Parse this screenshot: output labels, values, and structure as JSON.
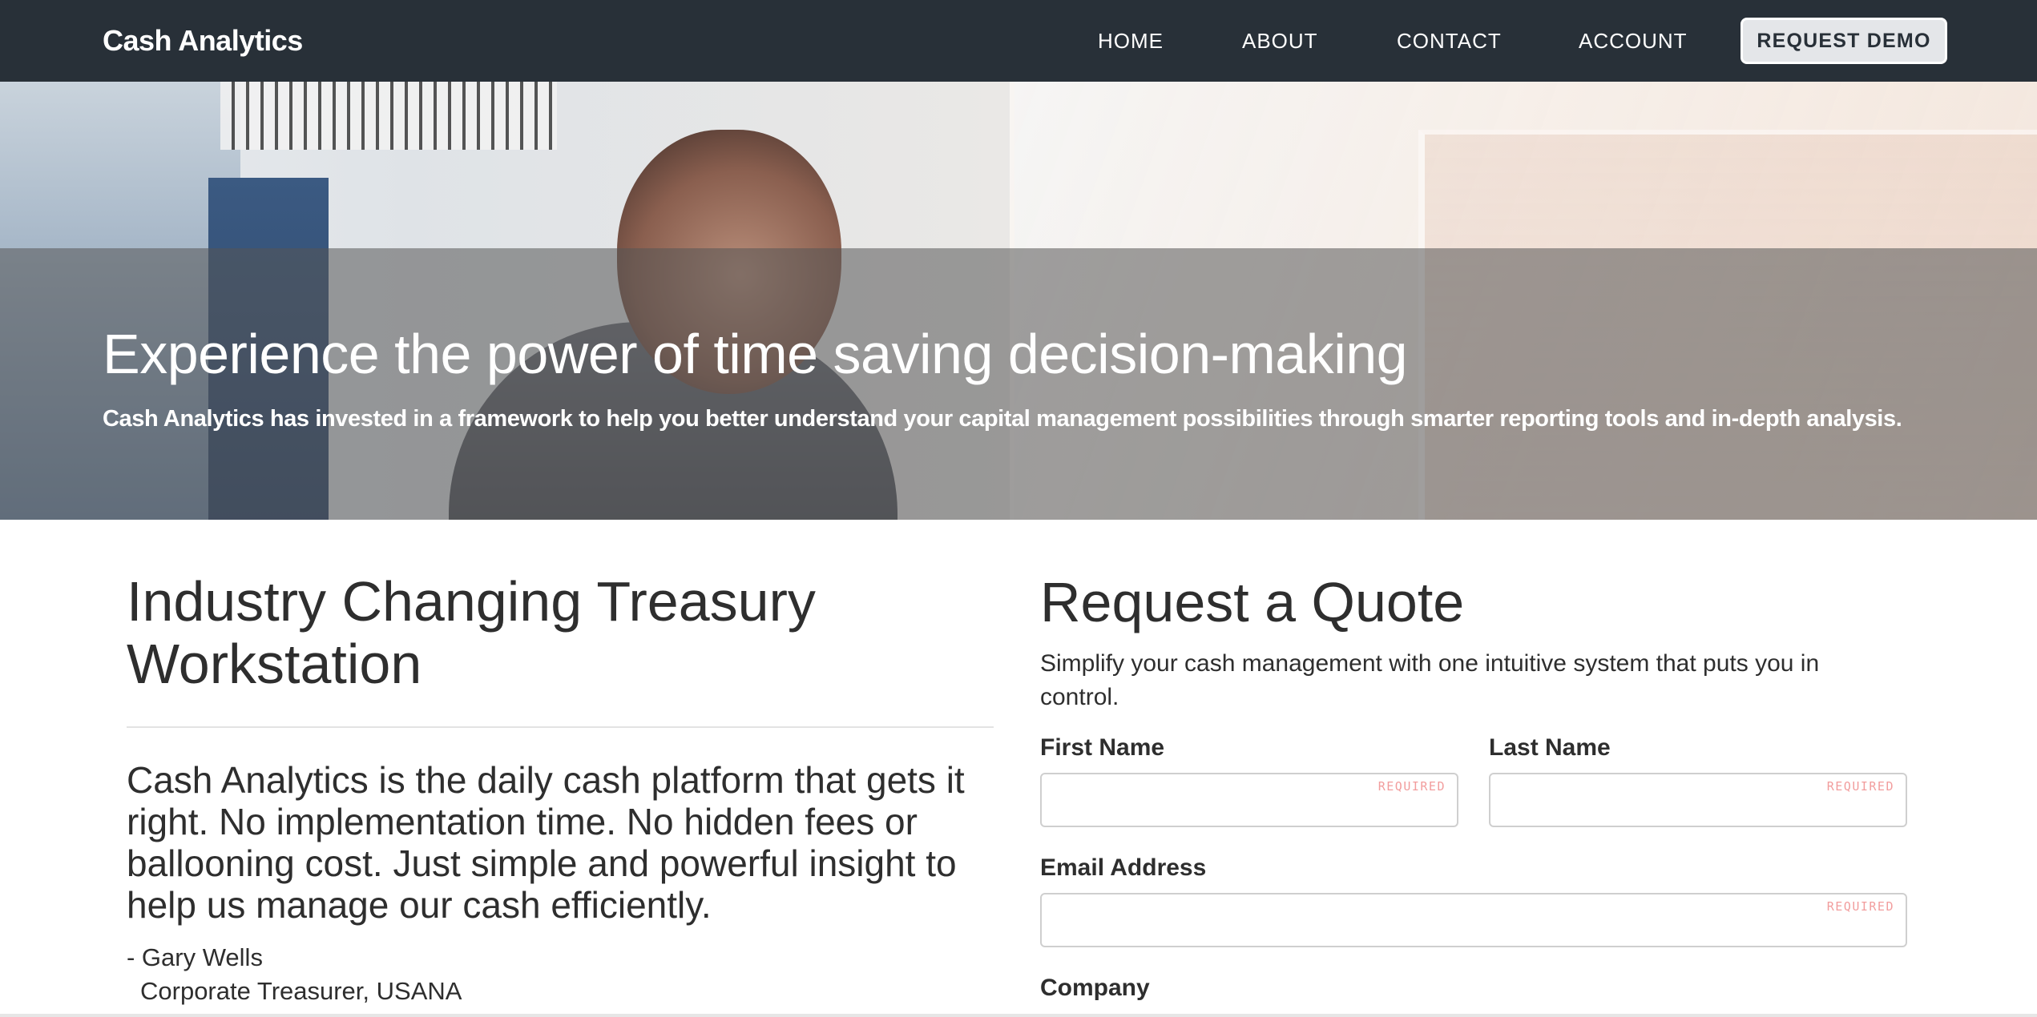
{
  "navbar": {
    "brand": "Cash Analytics",
    "links": [
      "HOME",
      "ABOUT",
      "CONTACT",
      "ACCOUNT"
    ],
    "cta": "REQUEST DEMO"
  },
  "hero": {
    "title": "Experience the power of time saving decision-making",
    "subtitle": "Cash Analytics has invested in a framework to help you better understand your capital management possibilities through smarter reporting tools and in-depth analysis."
  },
  "testimonial": {
    "heading": "Industry Changing  Treasury Workstation",
    "quote": "Cash Analytics is the daily cash platform that gets it right. No implementation time. No hidden fees or ballooning cost. Just simple and powerful insight to help us manage our cash efficiently.",
    "author": "- Gary Wells",
    "role": "Corporate Treasurer, USANA"
  },
  "quote_form": {
    "title": "Request a Quote",
    "intro": "Simplify your cash management with one intuitive system that puts you in control.",
    "first_name_label": "First Name",
    "last_name_label": "Last Name",
    "email_label": "Email Address",
    "company_label": "Company",
    "required_text": "REQUIRED"
  },
  "colors": {
    "navbar_bg": "#283038",
    "cta_bg": "#e4e6e9",
    "required_text": "#f29d9d"
  }
}
